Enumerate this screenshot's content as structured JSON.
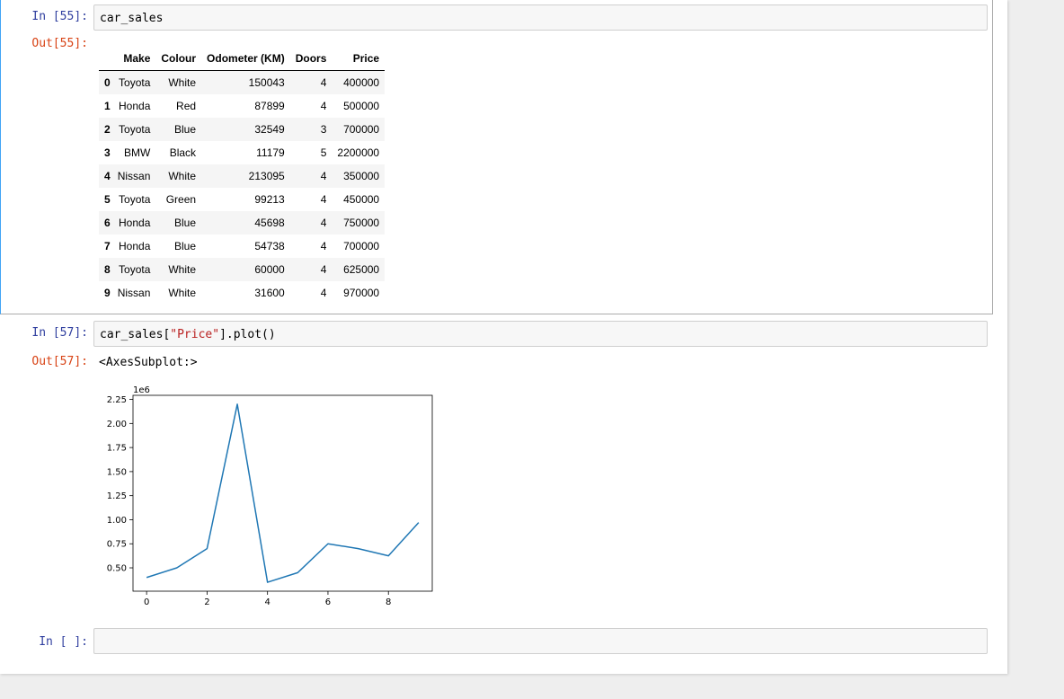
{
  "cells": [
    {
      "prompt_in": "In [55]:",
      "code": "car_sales",
      "prompt_out": "Out[55]:"
    },
    {
      "prompt_in": "In [57]:",
      "code_prefix": "car_sales[",
      "code_string": "\"Price\"",
      "code_suffix": "].plot()",
      "prompt_out": "Out[57]:",
      "output_text": "<AxesSubplot:>"
    },
    {
      "prompt_in": "In [ ]:",
      "code": ""
    }
  ],
  "table": {
    "columns": [
      "",
      "Make",
      "Colour",
      "Odometer (KM)",
      "Doors",
      "Price"
    ],
    "rows": [
      [
        "0",
        "Toyota",
        "White",
        "150043",
        "4",
        "400000"
      ],
      [
        "1",
        "Honda",
        "Red",
        "87899",
        "4",
        "500000"
      ],
      [
        "2",
        "Toyota",
        "Blue",
        "32549",
        "3",
        "700000"
      ],
      [
        "3",
        "BMW",
        "Black",
        "11179",
        "5",
        "2200000"
      ],
      [
        "4",
        "Nissan",
        "White",
        "213095",
        "4",
        "350000"
      ],
      [
        "5",
        "Toyota",
        "Green",
        "99213",
        "4",
        "450000"
      ],
      [
        "6",
        "Honda",
        "Blue",
        "45698",
        "4",
        "750000"
      ],
      [
        "7",
        "Honda",
        "Blue",
        "54738",
        "4",
        "700000"
      ],
      [
        "8",
        "Toyota",
        "White",
        "60000",
        "4",
        "625000"
      ],
      [
        "9",
        "Nissan",
        "White",
        "31600",
        "4",
        "970000"
      ]
    ]
  },
  "chart_data": {
    "type": "line",
    "x": [
      0,
      1,
      2,
      3,
      4,
      5,
      6,
      7,
      8,
      9
    ],
    "series": [
      {
        "values": [
          400000,
          500000,
          700000,
          2200000,
          350000,
          450000,
          750000,
          700000,
          625000,
          970000
        ],
        "color": "#1f77b4"
      }
    ],
    "xticks": [
      "0",
      "2",
      "4",
      "6",
      "8"
    ],
    "yticks": [
      "0.50",
      "0.75",
      "1.00",
      "1.25",
      "1.50",
      "1.75",
      "2.00",
      "2.25"
    ],
    "offset_label": "1e6",
    "xlim": [
      -0.45,
      9.45
    ],
    "ylim": [
      257500,
      2292500
    ],
    "grid": false
  },
  "colors": {
    "prompt_in": "#303f9f",
    "prompt_out": "#d84315",
    "selected_cell_border": "#42a5f5",
    "line": "#1f77b4"
  }
}
